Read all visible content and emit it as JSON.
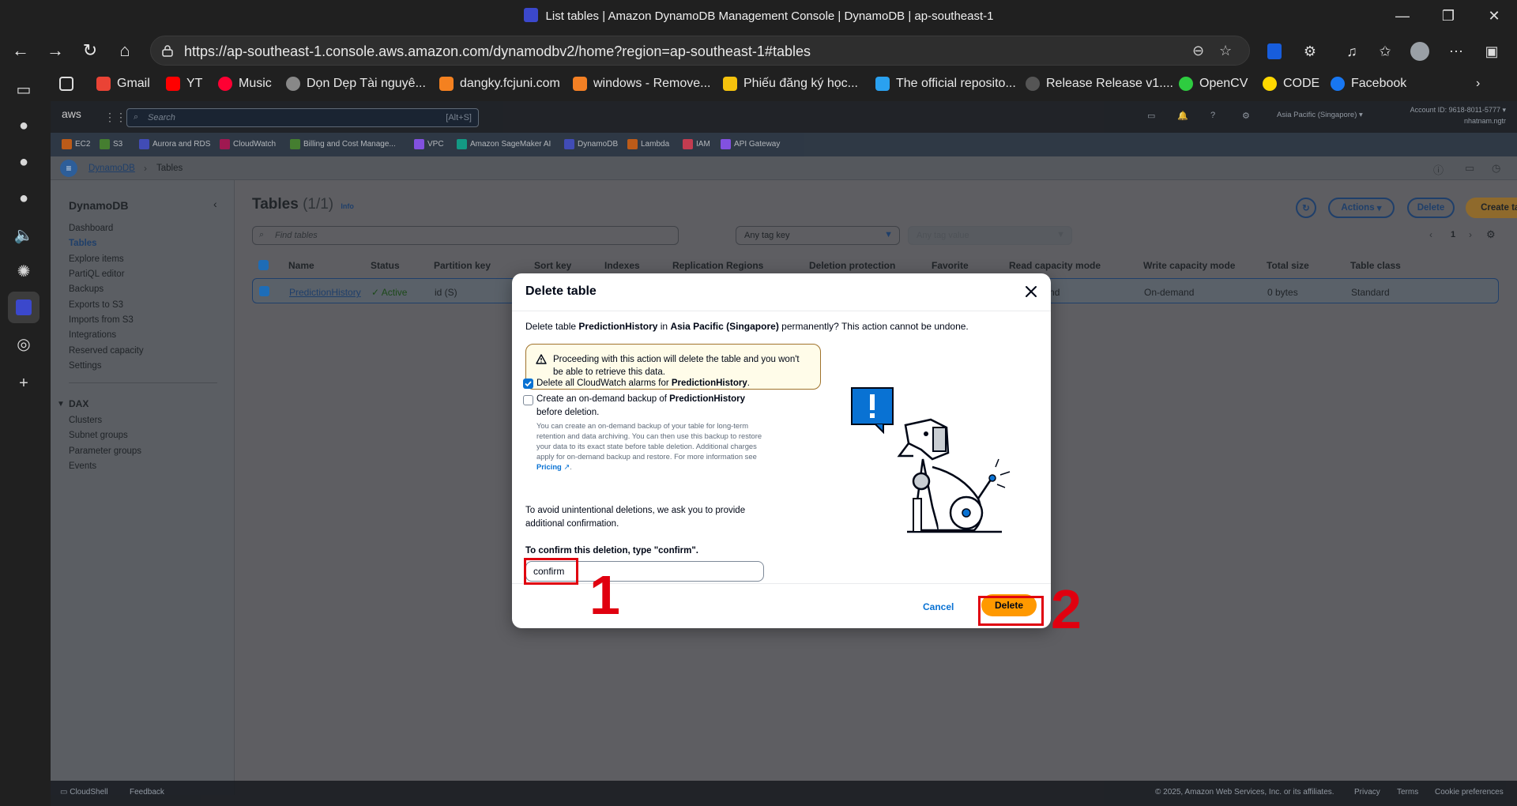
{
  "browser": {
    "window_title": "List tables | Amazon DynamoDB Management Console | DynamoDB | ap-southeast-1",
    "url": "https://ap-southeast-1.console.aws.amazon.com/dynamodbv2/home?region=ap-southeast-1#tables",
    "bookmarks": [
      "Gmail",
      "YT",
      "Music",
      "Dọn Dẹp Tài nguyê...",
      "dangky.fcjuni.com",
      "windows - Remove...",
      "Phiếu đăng ký học...",
      "The official reposito...",
      "Release Release v1....",
      "OpenCV",
      "CODE",
      "Facebook"
    ]
  },
  "aws": {
    "logo": "aws",
    "search_placeholder": "Search",
    "search_shortcut": "[Alt+S]",
    "region": "Asia Pacific (Singapore) ▾",
    "account_id": "Account ID: 9618-8011-5777 ▾",
    "account_user": "nhatnam.ngtr",
    "favorites": [
      "EC2",
      "S3",
      "Aurora and RDS",
      "CloudWatch",
      "Billing and Cost Manage...",
      "VPC",
      "Amazon SageMaker AI",
      "DynamoDB",
      "Lambda",
      "IAM",
      "API Gateway"
    ],
    "breadcrumb": {
      "root": "DynamoDB",
      "current": "Tables"
    },
    "footer": {
      "cloudshell": "CloudShell",
      "feedback": "Feedback",
      "copyright": "© 2025, Amazon Web Services, Inc. or its affiliates.",
      "privacy": "Privacy",
      "terms": "Terms",
      "cookies": "Cookie preferences"
    }
  },
  "leftnav": {
    "title": "DynamoDB",
    "items": [
      "Dashboard",
      "Tables",
      "Explore items",
      "PartiQL editor",
      "Backups",
      "Exports to S3",
      "Imports from S3",
      "Integrations",
      "Reserved capacity",
      "Settings"
    ],
    "dax_title": "DAX",
    "dax_items": [
      "Clusters",
      "Subnet groups",
      "Parameter groups",
      "Events"
    ]
  },
  "tables_page": {
    "title": "Tables",
    "count": "(1/1)",
    "info": "Info",
    "actions_label": "Actions",
    "delete_label": "Delete",
    "create_label": "Create table",
    "find_placeholder": "Find tables",
    "tag_key": "Any tag key",
    "tag_value": "Any tag value",
    "page": "1",
    "columns": [
      "Name",
      "Status",
      "Partition key",
      "Sort key",
      "Indexes",
      "Replication Regions",
      "Deletion protection",
      "Favorite",
      "Read capacity mode",
      "Write capacity mode",
      "Total size",
      "Table class"
    ],
    "row": {
      "name": "PredictionHistory",
      "status": "Active",
      "partition_key": "id (S)",
      "read_mode": "On-demand",
      "write_mode": "On-demand",
      "total_size": "0 bytes",
      "table_class": "Standard"
    }
  },
  "modal": {
    "title": "Delete table",
    "desc_pre": "Delete table ",
    "desc_table": "PredictionHistory",
    "desc_mid": " in ",
    "desc_region": "Asia Pacific (Singapore)",
    "desc_post": " permanently? This action cannot be undone.",
    "warning": "Proceeding with this action will delete the table and you won't be able to retrieve this data.",
    "cb1_pre": "Delete all CloudWatch alarms for ",
    "cb1_bold": "PredictionHistory",
    "cb1_post": ".",
    "cb2_pre": "Create an on-demand backup of ",
    "cb2_bold": "PredictionHistory",
    "cb2_post": " before deletion.",
    "cb2_help": "You can create an on-demand backup of your table for long-term retention and data archiving. You can then use this backup to restore your data to its exact state before table deletion. Additional charges apply for on-demand backup and restore. For more information see ",
    "pricing_link": "Pricing",
    "avoid_text": "To avoid unintentional deletions, we ask you to provide additional confirmation.",
    "confirm_label": "To confirm this deletion, type \"confirm\".",
    "confirm_value": "confirm",
    "cancel_label": "Cancel",
    "delete_label": "Delete"
  },
  "annotations": {
    "step1": "1",
    "step2": "2"
  },
  "colors": {
    "annotation_red": "#e0000f",
    "primary_orange": "#ff9900",
    "link_blue": "#0972d3"
  }
}
